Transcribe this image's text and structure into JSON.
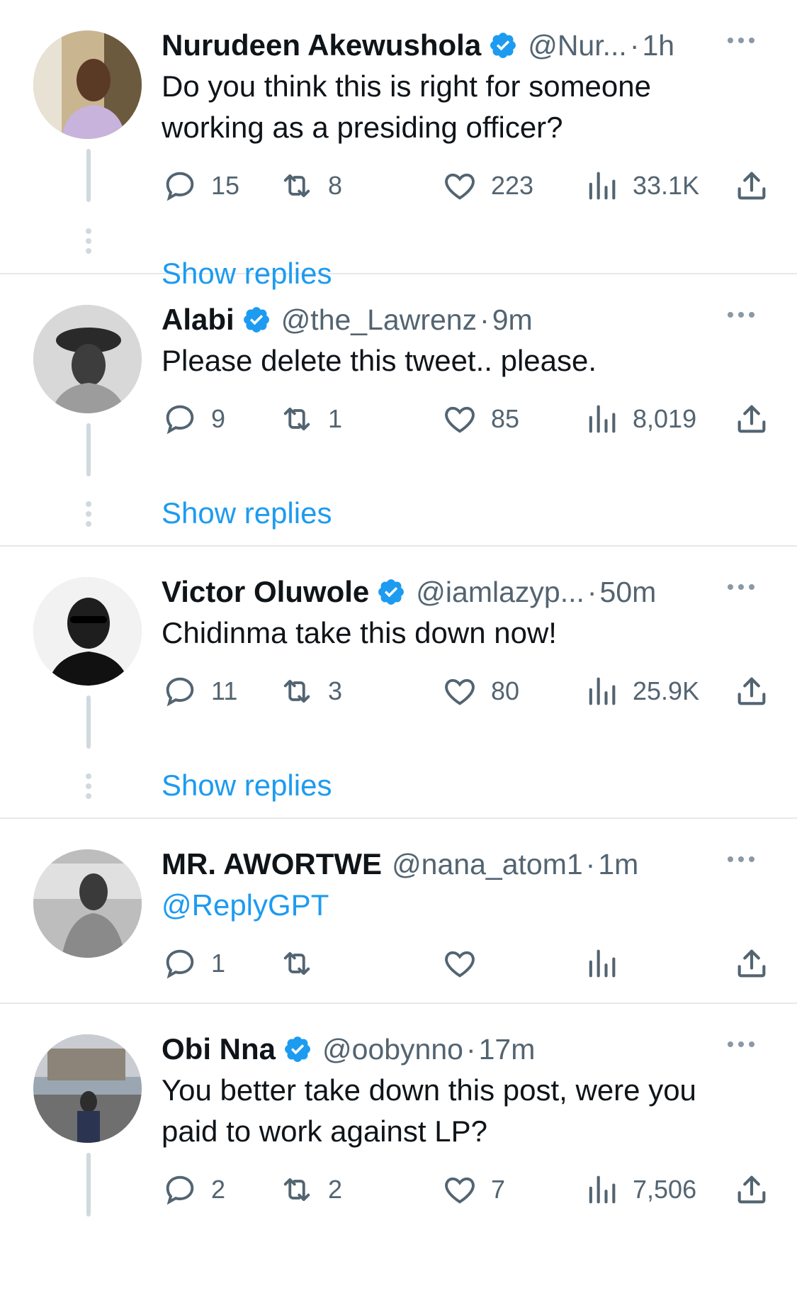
{
  "tweets": [
    {
      "name": "Nurudeen Akewushola",
      "verified": true,
      "handle": "@Nur...",
      "time": "1h",
      "text": [
        "Do you think this is right for someone",
        "working as a presiding officer?"
      ],
      "replies": "15",
      "retweets": "8",
      "likes": "223",
      "views": "33.1K",
      "show_replies": "Show replies"
    },
    {
      "name": "Alabi",
      "verified": true,
      "handle": "@the_Lawrenz",
      "time": "9m",
      "text": [
        "Please delete this tweet.. please."
      ],
      "replies": "9",
      "retweets": "1",
      "likes": "85",
      "views": "8,019",
      "show_replies": "Show replies"
    },
    {
      "name": "Victor Oluwole",
      "verified": true,
      "handle": "@iamlazyp...",
      "time": "50m",
      "text": [
        "Chidinma take this down now!"
      ],
      "replies": "11",
      "retweets": "3",
      "likes": "80",
      "views": "25.9K",
      "show_replies": "Show replies"
    },
    {
      "name": "MR. AWORTWE",
      "verified": false,
      "handle": "@nana_atom1",
      "time": "1m",
      "text": [
        "@ReplyGPT"
      ],
      "replies": "1",
      "retweets": "",
      "likes": "",
      "views": ""
    },
    {
      "name": "Obi Nna",
      "verified": true,
      "handle": "@oobynno",
      "time": "17m",
      "text": [
        "You better take down this post, were you",
        "paid to work against LP?"
      ],
      "replies": "2",
      "retweets": "2",
      "likes": "7",
      "views": "7,506"
    }
  ],
  "colors": {
    "accent": "#1d9bf0",
    "secondary_text": "#536471",
    "divider": "#e6e9ec",
    "thread_line": "#cfd9de"
  },
  "icons": [
    "reply-icon",
    "retweet-icon",
    "like-icon",
    "views-icon",
    "share-icon",
    "verified-badge-icon",
    "more-icon"
  ]
}
